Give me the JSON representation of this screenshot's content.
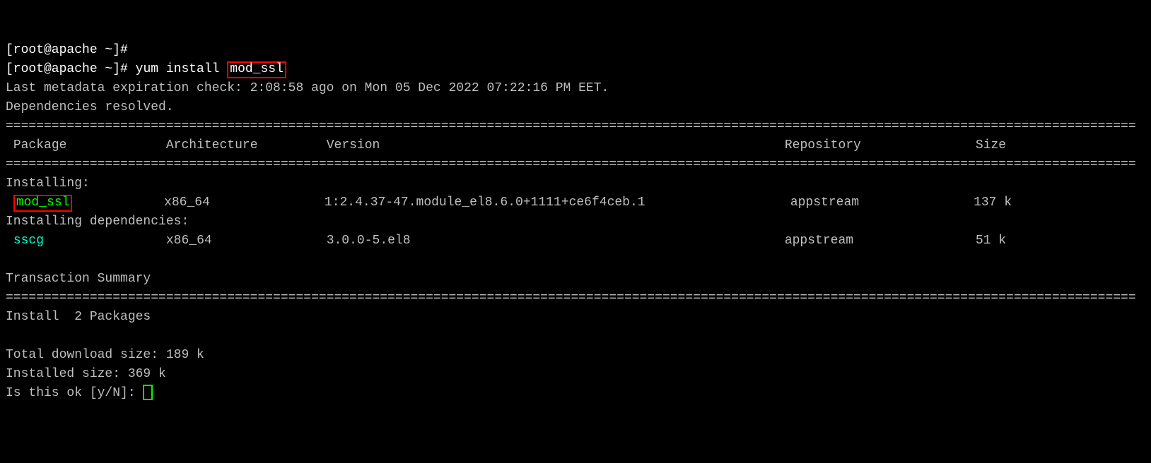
{
  "prompt_empty": "[root@apache ~]#",
  "prompt": "[root@apache ~]# ",
  "command_part1": "yum install ",
  "command_part2": "mod_ssl",
  "meta_line": "Last metadata expiration check: 2:08:58 ago on Mon 05 Dec 2022 07:22:16 PM EET.",
  "deps_line": "Dependencies resolved.",
  "hr": "====================================================================================================================================================",
  "table_headers": {
    "package": "Package",
    "arch": "Architecture",
    "version": "Version",
    "repo": "Repository",
    "size": "Size"
  },
  "installing_label": "Installing:",
  "row1": {
    "name": "mod_ssl",
    "arch": "x86_64",
    "version": "1:2.4.37-47.module_el8.6.0+1111+ce6f4ceb.1",
    "repo": "appstream",
    "size": "137 k"
  },
  "installing_deps_label": "Installing dependencies:",
  "row2": {
    "name": "sscg",
    "arch": "x86_64",
    "version": "3.0.0-5.el8",
    "repo": "appstream",
    "size": "51 k"
  },
  "summary_label": "Transaction Summary",
  "install_count": "Install  2 Packages",
  "download_size": "Total download size: 189 k",
  "installed_size": "Installed size: 369 k",
  "confirm_prompt": "Is this ok [y/N]: "
}
